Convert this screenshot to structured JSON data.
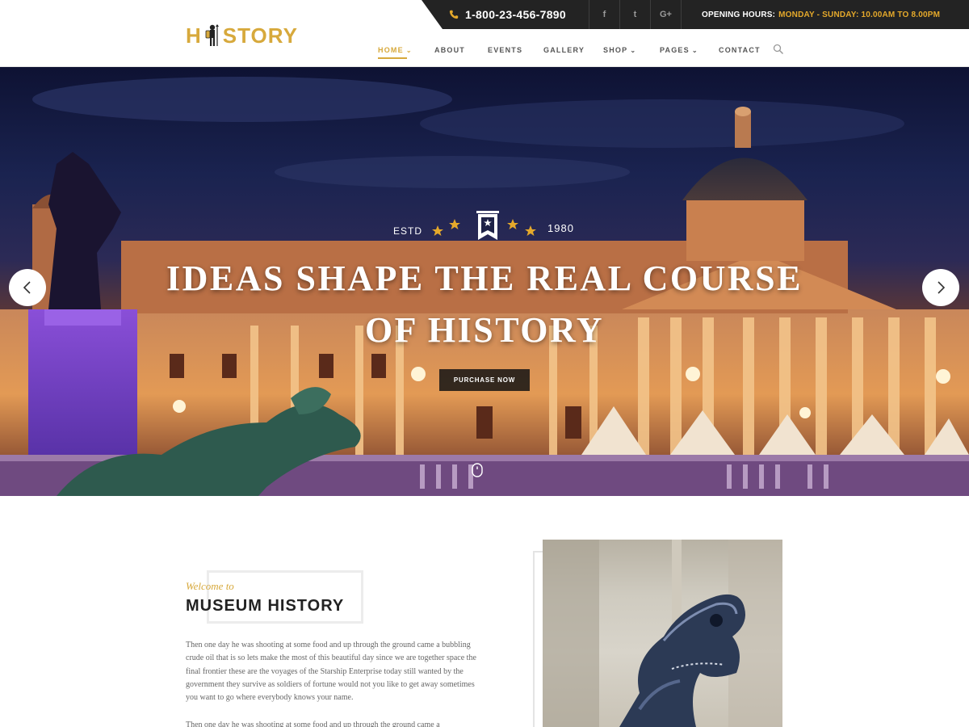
{
  "header": {
    "logo": {
      "left": "H",
      "right": "STORY"
    },
    "phone": "1-800-23-456-7890",
    "social": [
      {
        "icon": "facebook-icon",
        "glyph": "f"
      },
      {
        "icon": "twitter-icon",
        "glyph": "t"
      },
      {
        "icon": "google-plus-icon",
        "glyph": "G+"
      }
    ],
    "hours": {
      "label": "OPENING HOURS:",
      "value": "MONDAY - SUNDAY: 10.00AM TO 8.00PM"
    },
    "nav": [
      {
        "label": "HOME",
        "dropdown": true,
        "active": true
      },
      {
        "label": "ABOUT",
        "dropdown": false
      },
      {
        "label": "EVENTS",
        "dropdown": false
      },
      {
        "label": "GALLERY",
        "dropdown": false
      },
      {
        "label": "SHOP",
        "dropdown": true
      },
      {
        "label": "PAGES",
        "dropdown": true
      },
      {
        "label": "CONTACT",
        "dropdown": false
      }
    ]
  },
  "hero": {
    "estd_label": "ESTD",
    "year": "1980",
    "title_line1": "IDEAS SHAPE THE REAL COURSE",
    "title_line2": "OF HISTORY",
    "button": "PURCHASE NOW"
  },
  "about": {
    "welcome": "Welcome to",
    "title": "MUSEUM HISTORY",
    "paragraph1": "Then one day he was shooting at some food and up through the ground came a bubbling crude oil that is so lets make the most of this beautiful day since we are together space the final frontier these are the voyages of the Starship Enterprise today still wanted by the government they survive as soldiers of fortune would not you like to get away sometimes you want to go where everybody knows your name.",
    "paragraph2": "Then one day he was shooting at some food and up through the ground came a"
  },
  "colors": {
    "accent": "#d7a93c",
    "topbar": "#232323",
    "hours_value": "#e5a92b"
  }
}
